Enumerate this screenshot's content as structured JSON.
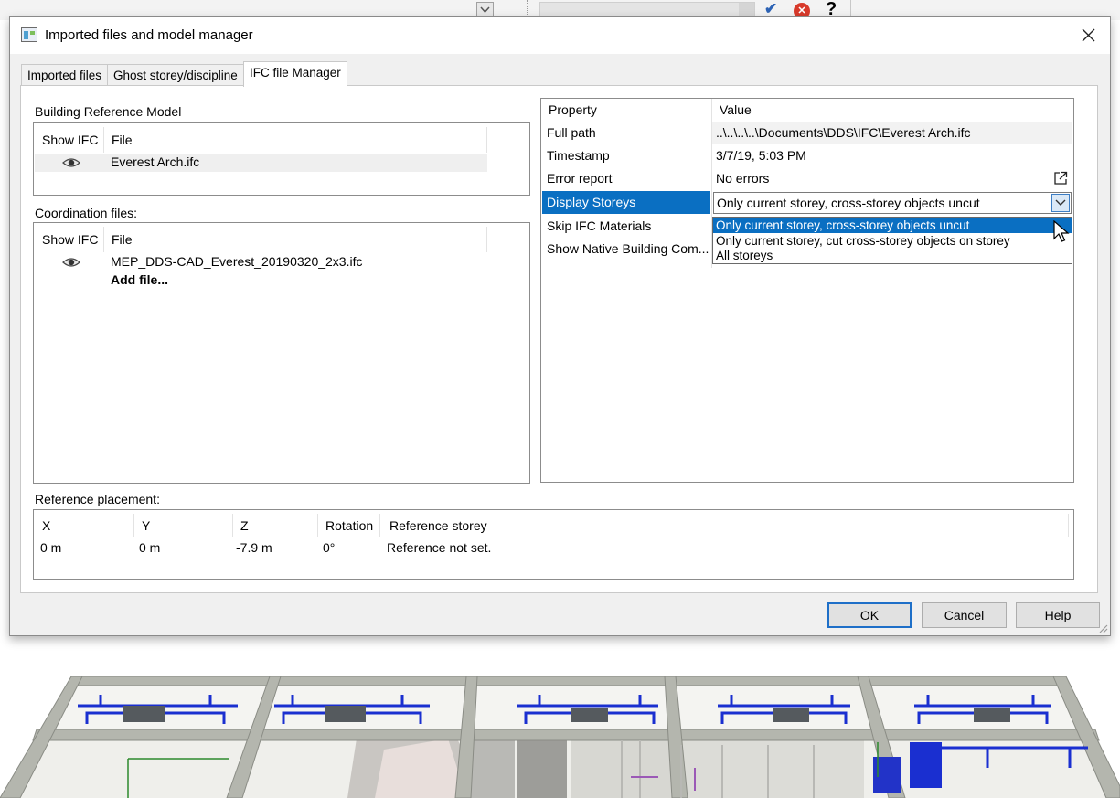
{
  "toolbar": {
    "confirm_icon": "checkmark-icon",
    "cancel_icon": "cancel-circle-icon",
    "help_label": "?"
  },
  "dialog": {
    "title": "Imported files and model manager",
    "tabs": [
      {
        "label": "Imported files",
        "active": false
      },
      {
        "label": "Ghost storey/discipline",
        "active": false
      },
      {
        "label": "IFC file Manager",
        "active": true
      }
    ],
    "building_reference": {
      "label": "Building Reference Model",
      "columns": [
        "Show IFC",
        "File"
      ],
      "rows": [
        {
          "visible_icon": "eye-icon",
          "file": "Everest Arch.ifc"
        }
      ]
    },
    "coordination": {
      "label": "Coordination files:",
      "columns": [
        "Show IFC",
        "File"
      ],
      "rows": [
        {
          "visible_icon": "eye-icon",
          "file": "MEP_DDS-CAD_Everest_20190320_2x3.ifc"
        }
      ],
      "add_label": "Add file..."
    },
    "properties": {
      "header": {
        "name": "Property",
        "value": "Value"
      },
      "rows": [
        {
          "name": "Full path",
          "value": "..\\..\\..\\..\\Documents\\DDS\\IFC\\Everest Arch.ifc"
        },
        {
          "name": "Timestamp",
          "value": "3/7/19, 5:03 PM"
        },
        {
          "name": "Error report",
          "value": "No errors"
        },
        {
          "name": "Display Storeys",
          "value": "Only current storey, cross-storey objects uncut"
        },
        {
          "name": "Skip IFC Materials",
          "value": ""
        },
        {
          "name": "Show Native Building Com...",
          "value": ""
        }
      ],
      "dropdown_options": [
        "Only current storey, cross-storey objects uncut",
        "Only current storey, cut cross-storey objects on storey",
        "All storeys"
      ]
    },
    "reference_placement": {
      "label": "Reference placement:",
      "columns": [
        "X",
        "Y",
        "Z",
        "Rotation",
        "Reference storey"
      ],
      "values": [
        "0 m",
        "0 m",
        "-7.9 m",
        "0°",
        "Reference not set."
      ]
    },
    "buttons": {
      "ok": "OK",
      "cancel": "Cancel",
      "help": "Help"
    }
  },
  "colors": {
    "selection": "#0a6fc2",
    "accent_border": "#1e6fc8"
  }
}
